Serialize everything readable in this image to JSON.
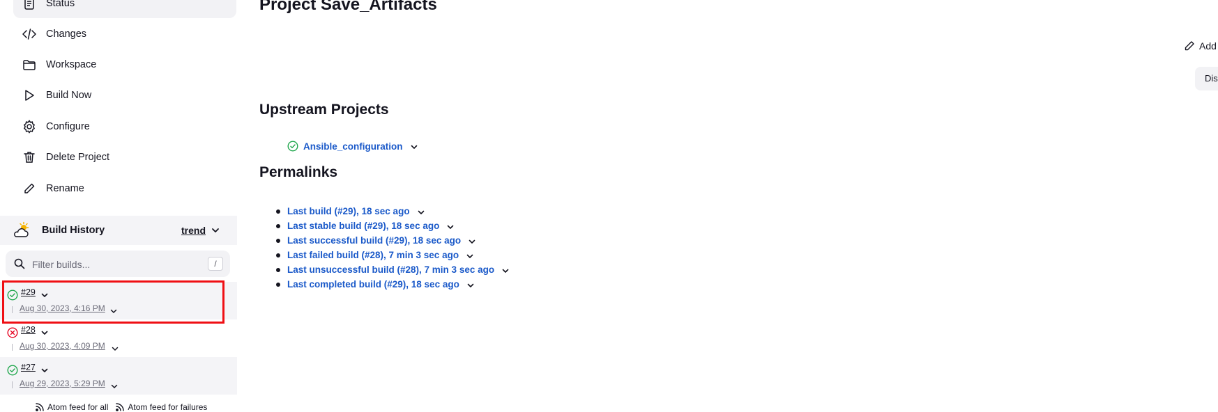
{
  "sidebar": {
    "tasks": [
      {
        "label": "Status",
        "icon": "document-icon"
      },
      {
        "label": "Changes",
        "icon": "code-icon"
      },
      {
        "label": "Workspace",
        "icon": "folder-icon"
      },
      {
        "label": "Build Now",
        "icon": "play-icon"
      },
      {
        "label": "Configure",
        "icon": "gear-icon"
      },
      {
        "label": "Delete Project",
        "icon": "trash-icon"
      },
      {
        "label": "Rename",
        "icon": "pencil-icon"
      }
    ],
    "build_history": {
      "title": "Build History",
      "trend_label": "trend",
      "filter_placeholder": "Filter builds...",
      "filter_shortcut": "/",
      "builds": [
        {
          "number": "#29",
          "date": "Aug 30, 2023, 4:16 PM",
          "status": "success"
        },
        {
          "number": "#28",
          "date": "Aug 30, 2023, 4:09 PM",
          "status": "failed"
        },
        {
          "number": "#27",
          "date": "Aug 29, 2023, 5:29 PM",
          "status": "success"
        }
      ],
      "feeds": {
        "all": "Atom feed for all",
        "failures": "Atom feed for failures"
      }
    }
  },
  "main": {
    "title": "Project Save_Artifacts",
    "add_description": "Add",
    "disable_button": "Dis",
    "upstream": {
      "title": "Upstream Projects",
      "items": [
        {
          "label": "Ansible_configuration",
          "status": "success"
        }
      ]
    },
    "permalinks": {
      "title": "Permalinks",
      "items": [
        "Last build (#29), 18 sec ago",
        "Last stable build (#29), 18 sec ago",
        "Last successful build (#29), 18 sec ago",
        "Last failed build (#28), 7 min 3 sec ago",
        "Last unsuccessful build (#28), 7 min 3 sec ago",
        "Last completed build (#29), 18 sec ago"
      ]
    }
  },
  "colors": {
    "link": "#1a59c9",
    "success": "#1ea64b",
    "failure": "#e6001f",
    "highlight": "#ef0f14"
  }
}
